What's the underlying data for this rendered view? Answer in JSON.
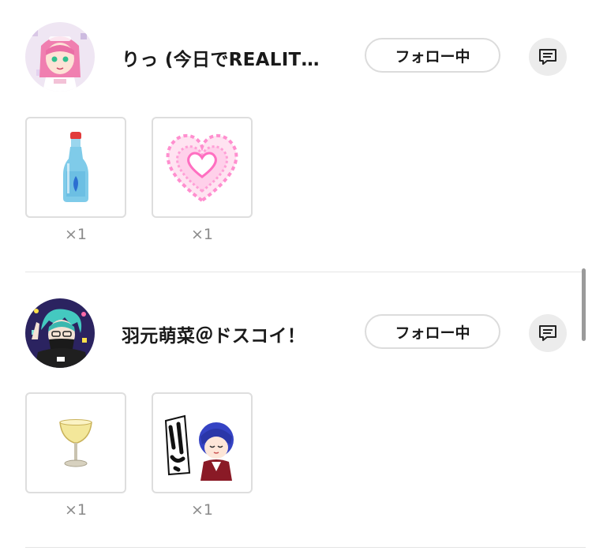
{
  "entries": [
    {
      "username": "りっ (今日でREALIT…",
      "follow_label": "フォロー中",
      "avatar_icon": "anime-girl-pink-hair-avatar",
      "gifts": [
        {
          "icon": "ramune-bottle-icon",
          "count": "×1"
        },
        {
          "icon": "pink-heart-icon",
          "count": "×1"
        }
      ]
    },
    {
      "username": "羽元萌菜＠ドスコイ！",
      "follow_label": "フォロー中",
      "avatar_icon": "masked-boy-teal-hair-avatar",
      "gifts": [
        {
          "icon": "cocktail-glass-icon",
          "count": "×1"
        },
        {
          "icon": "iin-sticker-icon",
          "count": "×1"
        }
      ]
    }
  ],
  "colors": {
    "border": "#dedede",
    "button_bg_gray": "#ececec",
    "count_text": "#8a8a8a"
  }
}
